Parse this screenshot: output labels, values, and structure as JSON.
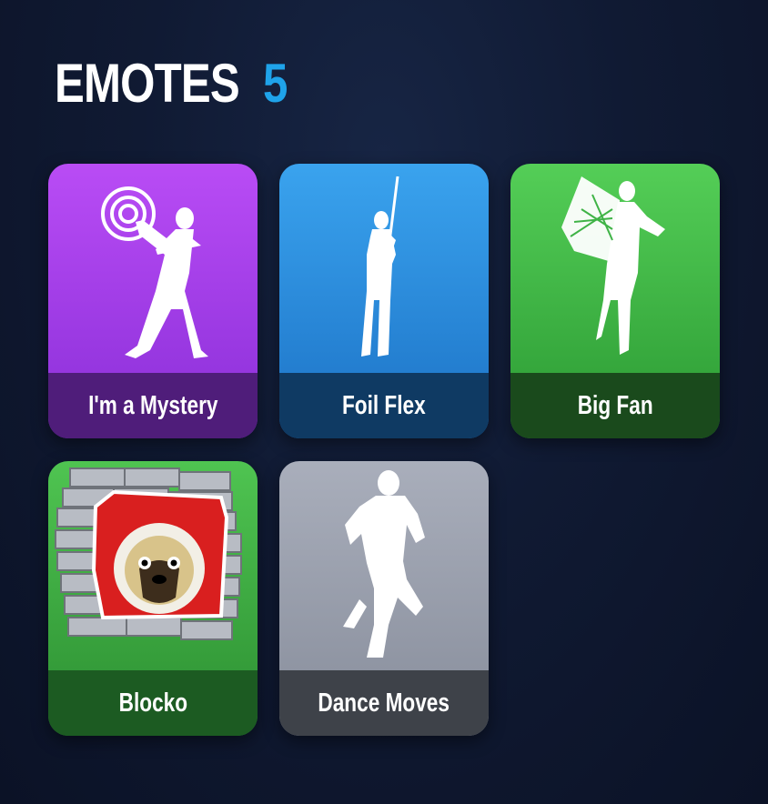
{
  "header": {
    "title": "EMOTES",
    "count": "5"
  },
  "emotes": [
    {
      "name": "I'm a Mystery",
      "icon": "dancer-mystery-icon"
    },
    {
      "name": "Foil Flex",
      "icon": "dancer-sword-icon"
    },
    {
      "name": "Big Fan",
      "icon": "dancer-fan-icon"
    },
    {
      "name": "Blocko",
      "icon": "pug-spray-icon"
    },
    {
      "name": "Dance Moves",
      "icon": "dancer-silhouette-icon"
    }
  ],
  "colors": {
    "accent": "#1fa3ea",
    "purple": "#b94cf5",
    "blue": "#3aa3ee",
    "green": "#54ce57",
    "gray": "#a9aebb"
  }
}
